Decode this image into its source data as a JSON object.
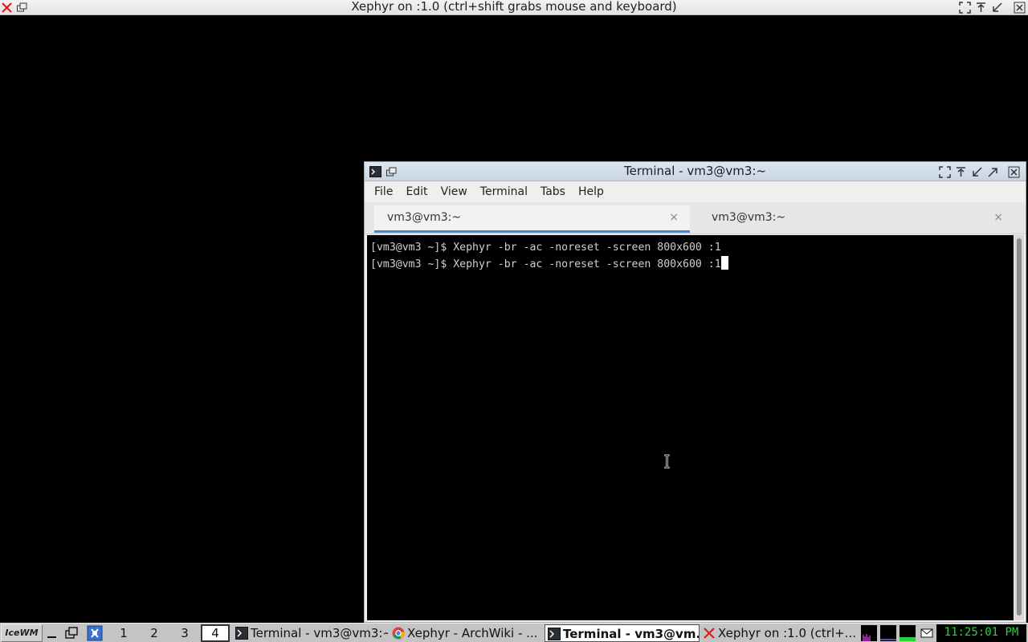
{
  "xephyr_window": {
    "title": "Xephyr on :1.0 (ctrl+shift grabs mouse and keyboard)"
  },
  "terminal_window": {
    "title": "Terminal - vm3@vm3:~",
    "menu": [
      "File",
      "Edit",
      "View",
      "Terminal",
      "Tabs",
      "Help"
    ],
    "tabs": [
      {
        "label": "vm3@vm3:~",
        "close": "×",
        "active": true
      },
      {
        "label": "vm3@vm3:~",
        "close": "×",
        "active": false
      }
    ],
    "lines": [
      "[vm3@vm3 ~]$ Xephyr -br -ac -noreset -screen 800x600 :1",
      "[vm3@vm3 ~]$ Xephyr -br -ac -noreset -screen 800x600 :1"
    ]
  },
  "taskbar": {
    "start_label": "IceWM",
    "workspaces": [
      "1",
      "2",
      "3",
      "4"
    ],
    "active_workspace": "4",
    "tasks": [
      {
        "label": "Terminal - vm3@vm3:~",
        "icon": "terminal-icon",
        "active": false
      },
      {
        "label": "Xephyr - ArchWiki - ...",
        "icon": "chrome-icon",
        "active": false
      },
      {
        "label": "Terminal - vm3@vm...",
        "icon": "terminal-icon",
        "active": true
      },
      {
        "label": "Xephyr on :1.0 (ctrl+...",
        "icon": "x-icon",
        "active": false
      }
    ],
    "clock": "11:25:01 PM"
  },
  "colors": {
    "desktop": "#000000",
    "terminal_bg": "#000000",
    "terminal_fg": "#cfcfcf",
    "tab_accent": "#3d87d8",
    "clock": "#2cd23a"
  }
}
